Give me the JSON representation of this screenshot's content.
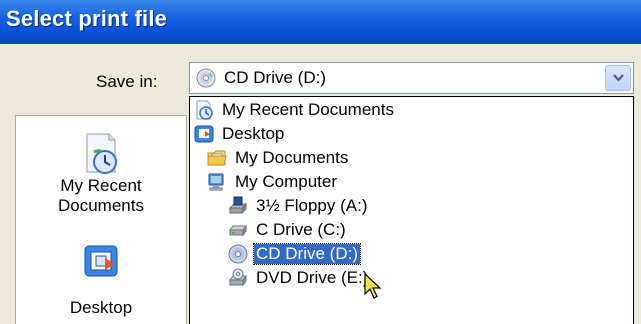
{
  "window": {
    "title": "Select print file"
  },
  "save_in": {
    "label": "Save in:",
    "value": "CD Drive (D:)",
    "icon": "cd-drive-icon"
  },
  "places_bar": [
    {
      "label_line1": "My Recent",
      "label_line2": "Documents",
      "icon": "recent-documents-icon"
    },
    {
      "label_line1": "Desktop",
      "icon": "desktop-icon"
    }
  ],
  "dropdown": {
    "items": [
      {
        "label": "My Recent Documents",
        "icon": "recent-documents-icon",
        "level": 0
      },
      {
        "label": "Desktop",
        "icon": "desktop-icon",
        "level": 0
      },
      {
        "label": "My Documents",
        "icon": "folder-icon",
        "level": 1
      },
      {
        "label": "My Computer",
        "icon": "computer-icon",
        "level": 1
      },
      {
        "label": "3½ Floppy (A:)",
        "icon": "floppy-drive-icon",
        "level": 2
      },
      {
        "label": "C Drive (C:)",
        "icon": "hard-drive-icon",
        "level": 2
      },
      {
        "label": "CD Drive (D:)",
        "icon": "cd-drive-icon",
        "level": 2,
        "selected": true
      },
      {
        "label": "DVD Drive (E:)",
        "icon": "dvd-drive-icon",
        "level": 2
      }
    ]
  },
  "colors": {
    "title_bar": "#0a52d8",
    "selection": "#316ac5",
    "dialog_bg": "#ece9d8"
  }
}
